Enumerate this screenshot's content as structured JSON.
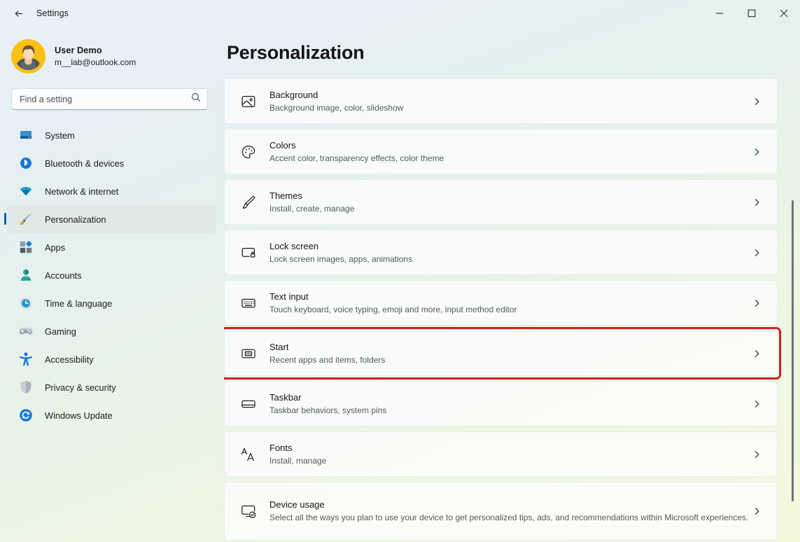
{
  "window": {
    "title": "Settings",
    "back_icon": "back-arrow-icon",
    "minimize_label": "—",
    "maximize_label": "□",
    "close_label": "✕"
  },
  "account": {
    "name": "User Demo",
    "email": "m__lab@outlook.com",
    "avatar_bg": "#f9c016"
  },
  "search": {
    "placeholder": "Find a setting",
    "value": "",
    "icon": "search-icon"
  },
  "sidebar": {
    "active_accent": "#0f5fb3",
    "items": [
      {
        "label": "System",
        "icon": "monitor-icon",
        "active": false
      },
      {
        "label": "Bluetooth & devices",
        "icon": "bluetooth-icon",
        "active": false
      },
      {
        "label": "Network & internet",
        "icon": "wifi-icon",
        "active": false
      },
      {
        "label": "Personalization",
        "icon": "paintbrush-icon",
        "active": true
      },
      {
        "label": "Apps",
        "icon": "apps-grid-icon",
        "active": false
      },
      {
        "label": "Accounts",
        "icon": "person-icon",
        "active": false
      },
      {
        "label": "Time & language",
        "icon": "clock-icon",
        "active": false
      },
      {
        "label": "Gaming",
        "icon": "gamepad-icon",
        "active": false
      },
      {
        "label": "Accessibility",
        "icon": "accessibility-icon",
        "active": false
      },
      {
        "label": "Privacy & security",
        "icon": "shield-icon",
        "active": false
      },
      {
        "label": "Windows Update",
        "icon": "update-refresh-icon",
        "active": false
      }
    ]
  },
  "main": {
    "page_title": "Personalization",
    "highlight_color": "#cf2026",
    "cards": [
      {
        "title": "Background",
        "subtitle": "Background image, color, slideshow",
        "icon": "image-icon",
        "highlighted": false
      },
      {
        "title": "Colors",
        "subtitle": "Accent color, transparency effects, color theme",
        "icon": "palette-icon",
        "highlighted": false
      },
      {
        "title": "Themes",
        "subtitle": "Install, create, manage",
        "icon": "paintbrush-icon",
        "highlighted": false
      },
      {
        "title": "Lock screen",
        "subtitle": "Lock screen images, apps, animations",
        "icon": "lock-screen-icon",
        "highlighted": false
      },
      {
        "title": "Text input",
        "subtitle": "Touch keyboard, voice typing, emoji and more, input method editor",
        "icon": "keyboard-icon",
        "highlighted": false
      },
      {
        "title": "Start",
        "subtitle": "Recent apps and items, folders",
        "icon": "start-menu-icon",
        "highlighted": true
      },
      {
        "title": "Taskbar",
        "subtitle": "Taskbar behaviors, system pins",
        "icon": "taskbar-icon",
        "highlighted": false
      },
      {
        "title": "Fonts",
        "subtitle": "Install, manage",
        "icon": "fonts-aa-icon",
        "highlighted": false
      },
      {
        "title": "Device usage",
        "subtitle": "Select all the ways you plan to use your device to get personalized tips, ads, and recommendations within Microsoft experiences.",
        "icon": "device-usage-icon",
        "highlighted": false,
        "tall": true
      }
    ]
  },
  "scrollbar": {
    "name": "vertical-scrollbar"
  }
}
